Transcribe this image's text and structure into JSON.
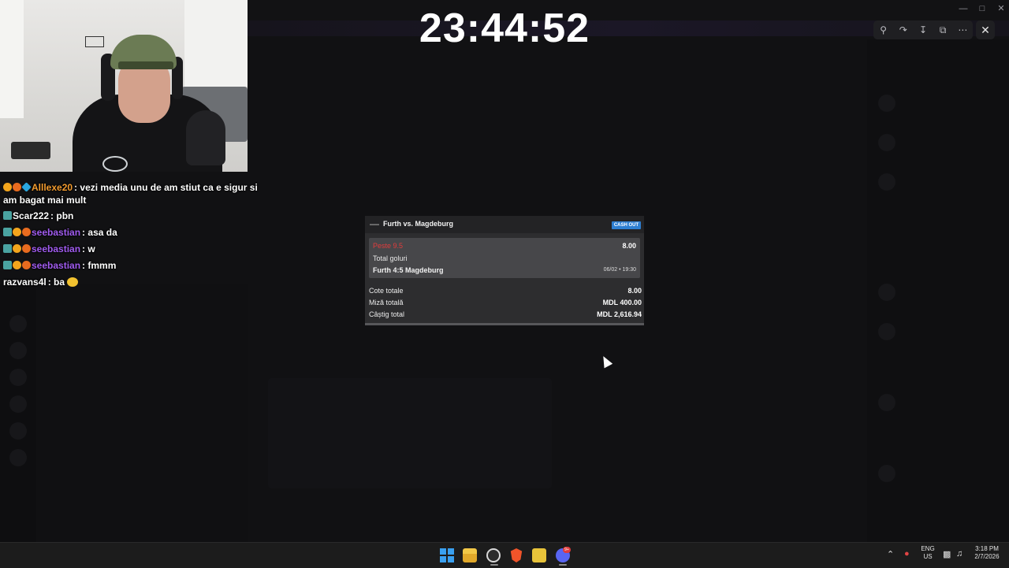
{
  "timer": "23:44:52",
  "chat": {
    "messages": [
      {
        "user": "Alllexe20",
        "user_color": "#f39b2e",
        "badges": [
          "one",
          "flame",
          "cube"
        ],
        "text": "vezi media unu de am stiut ca e sigur si am bagat mai mult"
      },
      {
        "user": "Scar222",
        "user_color": "#ffffff",
        "badges": [
          "grid"
        ],
        "text": "pbn"
      },
      {
        "user": "seebastian",
        "user_color": "#a15cf0",
        "badges": [
          "grid",
          "one",
          "flame"
        ],
        "text": "asa da"
      },
      {
        "user": "seebastian",
        "user_color": "#a15cf0",
        "badges": [
          "grid",
          "one",
          "flame"
        ],
        "text": "w"
      },
      {
        "user": "seebastian",
        "user_color": "#a15cf0",
        "badges": [
          "grid",
          "one",
          "flame"
        ],
        "text": "fmmm"
      },
      {
        "user": "razvans4l",
        "user_color": "#ffffff",
        "badges": [],
        "text": "ba",
        "emote": "thinking-emote"
      }
    ]
  },
  "bet_slip": {
    "title": "Furth vs. Magdeburg",
    "cashout_label": "CASH OUT",
    "selection": {
      "pick": "Peste 9.5",
      "odds": "8.00",
      "market": "Total goluri",
      "event": "Furth 4:5 Magdeburg",
      "datetime": "06/02 • 19:30"
    },
    "summary": [
      {
        "label": "Cote totale",
        "value": "8.00"
      },
      {
        "label": "Miză totală",
        "value": "MDL 400.00"
      },
      {
        "label": "Câștig total",
        "value": "MDL 2,616.94"
      }
    ],
    "colors": {
      "pick": "#e23c3c",
      "cashout": "#2e7fd1"
    }
  },
  "viewer_toolbar": {
    "icons": [
      "zoom-icon",
      "forward-icon",
      "download-icon",
      "open-external-icon",
      "more-icon"
    ],
    "close_icon": "close-icon"
  },
  "taskbar": {
    "apps": [
      "windows-start-icon",
      "file-explorer-icon",
      "chrome-icon",
      "brave-icon",
      "kick-icon",
      "discord-icon"
    ],
    "discord_badge": "9+",
    "language": "ENG",
    "region": "US",
    "time": "3:18 PM",
    "date": "2/7/2026"
  }
}
